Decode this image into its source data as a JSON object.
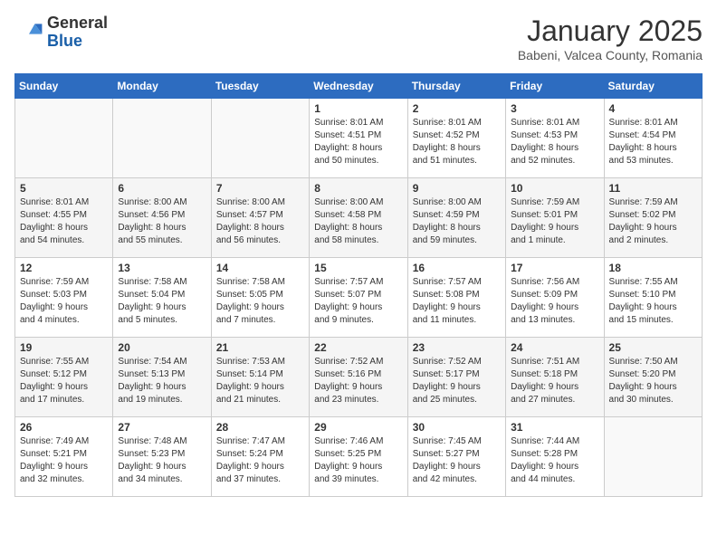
{
  "logo": {
    "general": "General",
    "blue": "Blue"
  },
  "title": "January 2025",
  "subtitle": "Babeni, Valcea County, Romania",
  "weekdays": [
    "Sunday",
    "Monday",
    "Tuesday",
    "Wednesday",
    "Thursday",
    "Friday",
    "Saturday"
  ],
  "weeks": [
    [
      {
        "day": "",
        "info": ""
      },
      {
        "day": "",
        "info": ""
      },
      {
        "day": "",
        "info": ""
      },
      {
        "day": "1",
        "info": "Sunrise: 8:01 AM\nSunset: 4:51 PM\nDaylight: 8 hours\nand 50 minutes."
      },
      {
        "day": "2",
        "info": "Sunrise: 8:01 AM\nSunset: 4:52 PM\nDaylight: 8 hours\nand 51 minutes."
      },
      {
        "day": "3",
        "info": "Sunrise: 8:01 AM\nSunset: 4:53 PM\nDaylight: 8 hours\nand 52 minutes."
      },
      {
        "day": "4",
        "info": "Sunrise: 8:01 AM\nSunset: 4:54 PM\nDaylight: 8 hours\nand 53 minutes."
      }
    ],
    [
      {
        "day": "5",
        "info": "Sunrise: 8:01 AM\nSunset: 4:55 PM\nDaylight: 8 hours\nand 54 minutes."
      },
      {
        "day": "6",
        "info": "Sunrise: 8:00 AM\nSunset: 4:56 PM\nDaylight: 8 hours\nand 55 minutes."
      },
      {
        "day": "7",
        "info": "Sunrise: 8:00 AM\nSunset: 4:57 PM\nDaylight: 8 hours\nand 56 minutes."
      },
      {
        "day": "8",
        "info": "Sunrise: 8:00 AM\nSunset: 4:58 PM\nDaylight: 8 hours\nand 58 minutes."
      },
      {
        "day": "9",
        "info": "Sunrise: 8:00 AM\nSunset: 4:59 PM\nDaylight: 8 hours\nand 59 minutes."
      },
      {
        "day": "10",
        "info": "Sunrise: 7:59 AM\nSunset: 5:01 PM\nDaylight: 9 hours\nand 1 minute."
      },
      {
        "day": "11",
        "info": "Sunrise: 7:59 AM\nSunset: 5:02 PM\nDaylight: 9 hours\nand 2 minutes."
      }
    ],
    [
      {
        "day": "12",
        "info": "Sunrise: 7:59 AM\nSunset: 5:03 PM\nDaylight: 9 hours\nand 4 minutes."
      },
      {
        "day": "13",
        "info": "Sunrise: 7:58 AM\nSunset: 5:04 PM\nDaylight: 9 hours\nand 5 minutes."
      },
      {
        "day": "14",
        "info": "Sunrise: 7:58 AM\nSunset: 5:05 PM\nDaylight: 9 hours\nand 7 minutes."
      },
      {
        "day": "15",
        "info": "Sunrise: 7:57 AM\nSunset: 5:07 PM\nDaylight: 9 hours\nand 9 minutes."
      },
      {
        "day": "16",
        "info": "Sunrise: 7:57 AM\nSunset: 5:08 PM\nDaylight: 9 hours\nand 11 minutes."
      },
      {
        "day": "17",
        "info": "Sunrise: 7:56 AM\nSunset: 5:09 PM\nDaylight: 9 hours\nand 13 minutes."
      },
      {
        "day": "18",
        "info": "Sunrise: 7:55 AM\nSunset: 5:10 PM\nDaylight: 9 hours\nand 15 minutes."
      }
    ],
    [
      {
        "day": "19",
        "info": "Sunrise: 7:55 AM\nSunset: 5:12 PM\nDaylight: 9 hours\nand 17 minutes."
      },
      {
        "day": "20",
        "info": "Sunrise: 7:54 AM\nSunset: 5:13 PM\nDaylight: 9 hours\nand 19 minutes."
      },
      {
        "day": "21",
        "info": "Sunrise: 7:53 AM\nSunset: 5:14 PM\nDaylight: 9 hours\nand 21 minutes."
      },
      {
        "day": "22",
        "info": "Sunrise: 7:52 AM\nSunset: 5:16 PM\nDaylight: 9 hours\nand 23 minutes."
      },
      {
        "day": "23",
        "info": "Sunrise: 7:52 AM\nSunset: 5:17 PM\nDaylight: 9 hours\nand 25 minutes."
      },
      {
        "day": "24",
        "info": "Sunrise: 7:51 AM\nSunset: 5:18 PM\nDaylight: 9 hours\nand 27 minutes."
      },
      {
        "day": "25",
        "info": "Sunrise: 7:50 AM\nSunset: 5:20 PM\nDaylight: 9 hours\nand 30 minutes."
      }
    ],
    [
      {
        "day": "26",
        "info": "Sunrise: 7:49 AM\nSunset: 5:21 PM\nDaylight: 9 hours\nand 32 minutes."
      },
      {
        "day": "27",
        "info": "Sunrise: 7:48 AM\nSunset: 5:23 PM\nDaylight: 9 hours\nand 34 minutes."
      },
      {
        "day": "28",
        "info": "Sunrise: 7:47 AM\nSunset: 5:24 PM\nDaylight: 9 hours\nand 37 minutes."
      },
      {
        "day": "29",
        "info": "Sunrise: 7:46 AM\nSunset: 5:25 PM\nDaylight: 9 hours\nand 39 minutes."
      },
      {
        "day": "30",
        "info": "Sunrise: 7:45 AM\nSunset: 5:27 PM\nDaylight: 9 hours\nand 42 minutes."
      },
      {
        "day": "31",
        "info": "Sunrise: 7:44 AM\nSunset: 5:28 PM\nDaylight: 9 hours\nand 44 minutes."
      },
      {
        "day": "",
        "info": ""
      }
    ]
  ]
}
